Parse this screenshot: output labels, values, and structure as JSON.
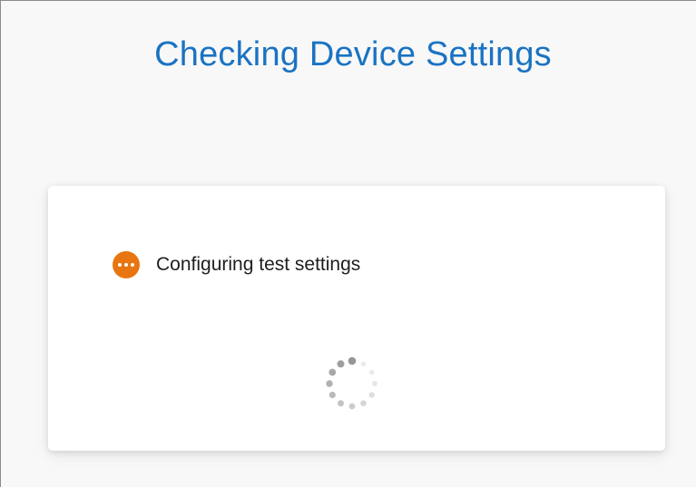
{
  "page": {
    "title": "Checking Device Settings"
  },
  "status": {
    "icon": "ellipsis-circle-icon",
    "label": "Configuring test settings",
    "color": "#e87511"
  },
  "spinner": {
    "icon": "loading-spinner-icon"
  },
  "colors": {
    "title": "#1a73c2",
    "background": "#f8f8f8",
    "card": "#ffffff"
  }
}
